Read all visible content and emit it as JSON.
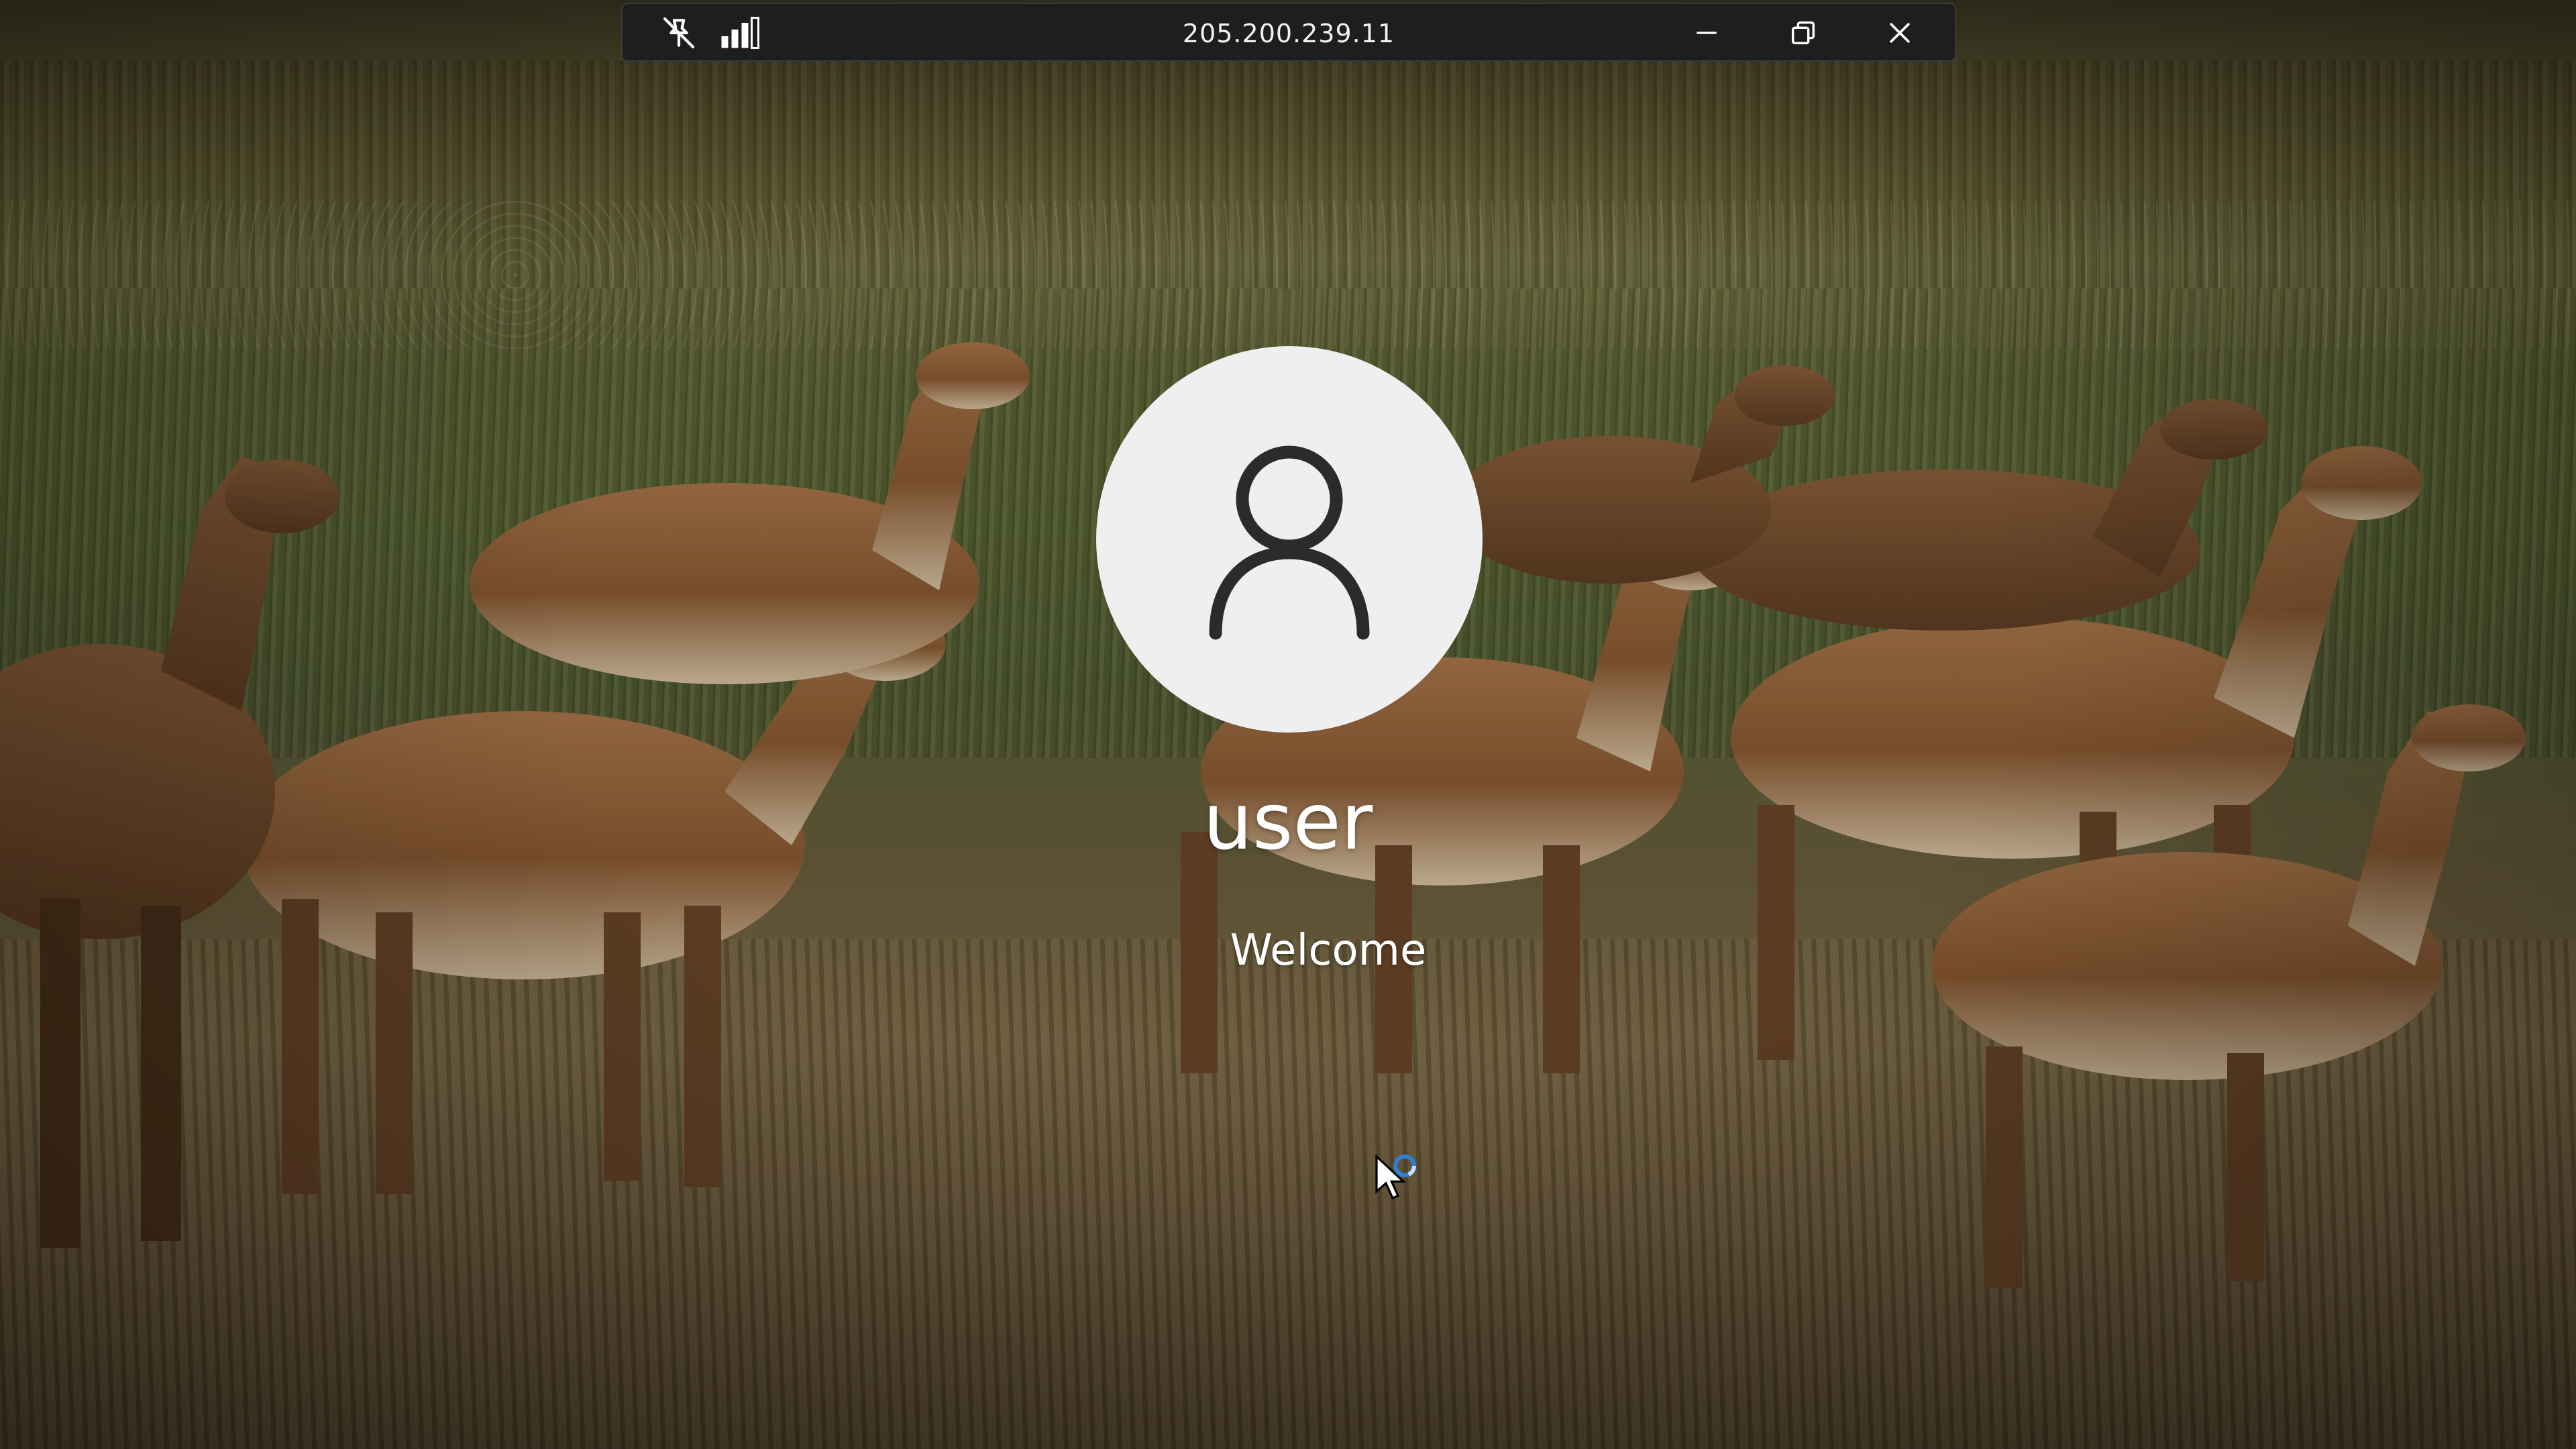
{
  "connection_bar": {
    "title": "205.200.239.11",
    "icons": [
      "pin-off-icon",
      "signal-strength-icon",
      "minimize-icon",
      "restore-icon",
      "close-icon"
    ]
  },
  "login": {
    "username": "user",
    "status": "Welcome"
  },
  "wallpaper": {
    "subject": "guanaco herd in grassland"
  },
  "colors": {
    "bar_background": "#1e1e1e",
    "avatar_background": "#efefef",
    "avatar_glyph": "#2b2b2b",
    "spinner": "#2f7fd6"
  }
}
